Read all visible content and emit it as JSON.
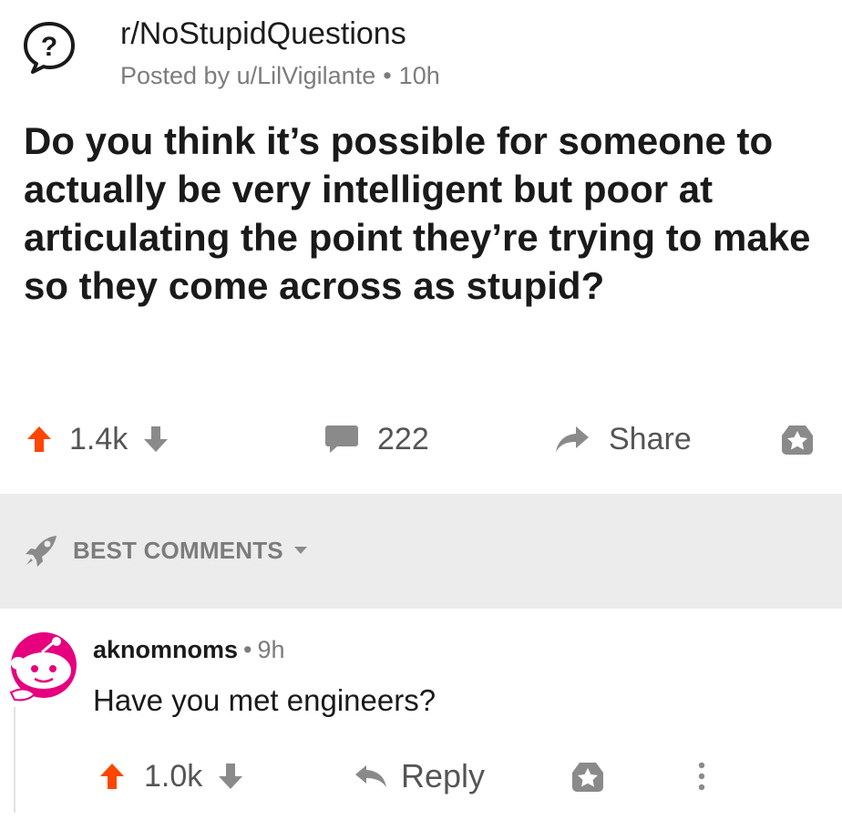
{
  "post": {
    "subreddit": "r/NoStupidQuestions",
    "posted_by_prefix": "Posted by",
    "author": "u/LilVigilante",
    "separator": "•",
    "time": "10h",
    "title": "Do you think it’s possible for someone to actually be very intelligent but poor at articulating the point they’re trying to make so they come across as stupid?",
    "score": "1.4k",
    "comments": "222",
    "share_label": "Share"
  },
  "sort": {
    "label": "BEST COMMENTS"
  },
  "comment": {
    "author": "aknomnoms",
    "separator": "•",
    "time": "9h",
    "body": "Have you met engineers?",
    "score": "1.0k",
    "reply_label": "Reply"
  },
  "colors": {
    "upvote_active": "#ff4500",
    "icon_gray": "#8a8a8a",
    "text_muted": "#7c7c7c",
    "sort_bar_bg": "#ececec",
    "avatar_pink": "#e6007e"
  },
  "icons": {
    "subreddit": "question-bubble-icon",
    "upvote": "upvote-arrow-icon",
    "downvote": "downvote-arrow-icon",
    "comments": "comment-bubble-icon",
    "share": "share-arrow-icon",
    "award": "award-icon",
    "sort": "rocket-icon",
    "caret": "caret-down-icon",
    "reply": "reply-arrow-icon",
    "more": "more-vertical-icon",
    "avatar": "snoo-avatar-icon"
  }
}
